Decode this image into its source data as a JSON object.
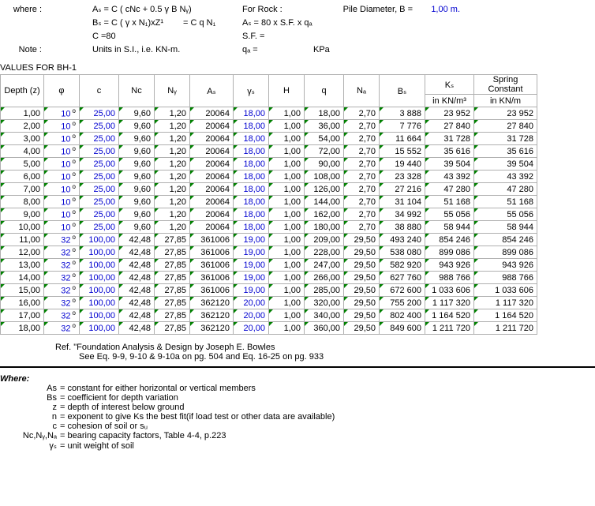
{
  "header": {
    "where": "where :",
    "as_eq": "Aₛ = C ( cNᴄ + 0.5 γ B Nᵧ)",
    "for_rock": "For Rock :",
    "pile_d_lbl": "Pile Diameter, B  =",
    "pile_d_val": "1,00 m.",
    "bs_eq": "Bₛ = C ( γ x N₁)xZ¹",
    "bs_eq2": "= C q N₁",
    "as_rock": "Aₛ = 80 x S.F. x qₐ",
    "c_eq": "C =80",
    "sf_eq": "S.F. =",
    "note": "Note :",
    "units": "Units in S.I., i.e. KN-m.",
    "qa_eq": "qₐ =",
    "kpa": "KPa"
  },
  "section": "VALUES FOR BH-1",
  "cols": {
    "z": "Depth (z)",
    "phi": "φ",
    "c": "c",
    "nc": "Nᴄ",
    "ny": "Nᵧ",
    "as": "Aₛ",
    "ys": "γₛ",
    "h": "H",
    "q": "q",
    "nq": "Nₐ",
    "bs": "Bₛ",
    "ks": "Kₛ",
    "ks_unit": "in KN/m³",
    "sp": "Spring Constant",
    "sp_unit": "in KN/m"
  },
  "chart_data": {
    "type": "table",
    "columns": [
      "Depth (z)",
      "phi",
      "c",
      "Nc",
      "Ny",
      "As",
      "ys",
      "H",
      "q",
      "Nq",
      "Bs",
      "Ks",
      "Spring Constant"
    ],
    "rows": [
      [
        "1,00",
        "10",
        "25,00",
        "9,60",
        "1,20",
        "20064",
        "18,00",
        "1,00",
        "18,00",
        "2,70",
        "3 888",
        "23 952",
        "23 952"
      ],
      [
        "2,00",
        "10",
        "25,00",
        "9,60",
        "1,20",
        "20064",
        "18,00",
        "1,00",
        "36,00",
        "2,70",
        "7 776",
        "27 840",
        "27 840"
      ],
      [
        "3,00",
        "10",
        "25,00",
        "9,60",
        "1,20",
        "20064",
        "18,00",
        "1,00",
        "54,00",
        "2,70",
        "11 664",
        "31 728",
        "31 728"
      ],
      [
        "4,00",
        "10",
        "25,00",
        "9,60",
        "1,20",
        "20064",
        "18,00",
        "1,00",
        "72,00",
        "2,70",
        "15 552",
        "35 616",
        "35 616"
      ],
      [
        "5,00",
        "10",
        "25,00",
        "9,60",
        "1,20",
        "20064",
        "18,00",
        "1,00",
        "90,00",
        "2,70",
        "19 440",
        "39 504",
        "39 504"
      ],
      [
        "6,00",
        "10",
        "25,00",
        "9,60",
        "1,20",
        "20064",
        "18,00",
        "1,00",
        "108,00",
        "2,70",
        "23 328",
        "43 392",
        "43 392"
      ],
      [
        "7,00",
        "10",
        "25,00",
        "9,60",
        "1,20",
        "20064",
        "18,00",
        "1,00",
        "126,00",
        "2,70",
        "27 216",
        "47 280",
        "47 280"
      ],
      [
        "8,00",
        "10",
        "25,00",
        "9,60",
        "1,20",
        "20064",
        "18,00",
        "1,00",
        "144,00",
        "2,70",
        "31 104",
        "51 168",
        "51 168"
      ],
      [
        "9,00",
        "10",
        "25,00",
        "9,60",
        "1,20",
        "20064",
        "18,00",
        "1,00",
        "162,00",
        "2,70",
        "34 992",
        "55 056",
        "55 056"
      ],
      [
        "10,00",
        "10",
        "25,00",
        "9,60",
        "1,20",
        "20064",
        "18,00",
        "1,00",
        "180,00",
        "2,70",
        "38 880",
        "58 944",
        "58 944"
      ],
      [
        "11,00",
        "32",
        "100,00",
        "42,48",
        "27,85",
        "361006",
        "19,00",
        "1,00",
        "209,00",
        "29,50",
        "493 240",
        "854 246",
        "854 246"
      ],
      [
        "12,00",
        "32",
        "100,00",
        "42,48",
        "27,85",
        "361006",
        "19,00",
        "1,00",
        "228,00",
        "29,50",
        "538 080",
        "899 086",
        "899 086"
      ],
      [
        "13,00",
        "32",
        "100,00",
        "42,48",
        "27,85",
        "361006",
        "19,00",
        "1,00",
        "247,00",
        "29,50",
        "582 920",
        "943 926",
        "943 926"
      ],
      [
        "14,00",
        "32",
        "100,00",
        "42,48",
        "27,85",
        "361006",
        "19,00",
        "1,00",
        "266,00",
        "29,50",
        "627 760",
        "988 766",
        "988 766"
      ],
      [
        "15,00",
        "32",
        "100,00",
        "42,48",
        "27,85",
        "361006",
        "19,00",
        "1,00",
        "285,00",
        "29,50",
        "672 600",
        "1 033 606",
        "1 033 606"
      ],
      [
        "16,00",
        "32",
        "100,00",
        "42,48",
        "27,85",
        "362120",
        "20,00",
        "1,00",
        "320,00",
        "29,50",
        "755 200",
        "1 117 320",
        "1 117 320"
      ],
      [
        "17,00",
        "32",
        "100,00",
        "42,48",
        "27,85",
        "362120",
        "20,00",
        "1,00",
        "340,00",
        "29,50",
        "802 400",
        "1 164 520",
        "1 164 520"
      ],
      [
        "18,00",
        "32",
        "100,00",
        "42,48",
        "27,85",
        "362120",
        "20,00",
        "1,00",
        "360,00",
        "29,50",
        "849 600",
        "1 211 720",
        "1 211 720"
      ]
    ]
  },
  "ref": {
    "l1": "Ref. \"Foundation Analysis & Design by Joseph E. Bowles",
    "l2": "See Eq. 9-9, 9-10 & 9-10a on pg. 504 and Eq. 16-25 on pg. 933"
  },
  "where2": {
    "title": "Where:",
    "items": [
      {
        "lbl": "As",
        "txt": "= constant for either horizontal or vertical members"
      },
      {
        "lbl": "Bs",
        "txt": "= coefficient for depth variation"
      },
      {
        "lbl": "z",
        "txt": "= depth of interest below ground"
      },
      {
        "lbl": "n",
        "txt": "= exponent to give Ks the best fit(if load test or other data are available)"
      },
      {
        "lbl": "c",
        "txt": "= cohesion of soil or sᵤ"
      },
      {
        "lbl": "Nᴄ,Nᵧ,Nₐ",
        "txt": "= bearing capacity factors, Table 4-4, p.223"
      },
      {
        "lbl": "γₛ",
        "txt": "= unit weight of soil"
      }
    ]
  }
}
